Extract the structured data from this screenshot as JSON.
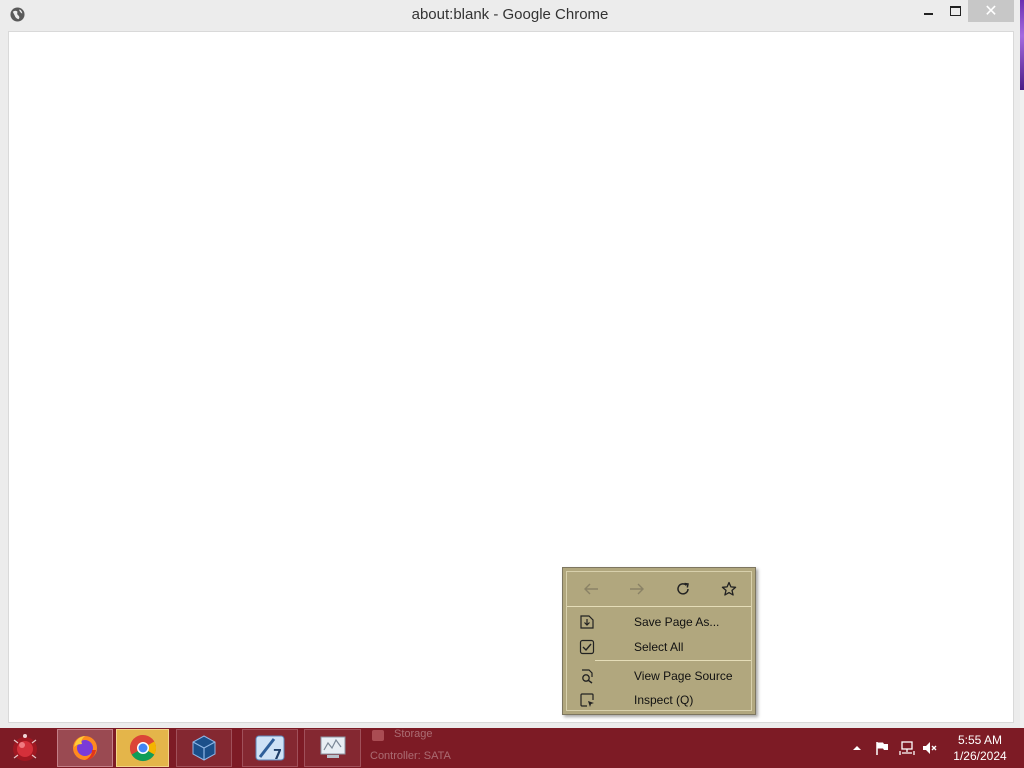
{
  "window": {
    "title": "about:blank - Google Chrome",
    "close_glyph": "✕"
  },
  "context_menu": {
    "nav": [
      {
        "name": "back",
        "icon": "arrow-left-icon",
        "enabled": false
      },
      {
        "name": "forward",
        "icon": "arrow-right-icon",
        "enabled": false
      },
      {
        "name": "reload",
        "icon": "reload-icon",
        "enabled": true
      },
      {
        "name": "bookmark",
        "icon": "star-icon",
        "enabled": true
      }
    ],
    "items": [
      {
        "label": "Save Page As...",
        "icon": "save-page-icon"
      },
      {
        "label": "Select All",
        "icon": "select-all-icon"
      },
      {
        "label": "View Page Source",
        "icon": "view-source-icon"
      },
      {
        "label": "Inspect (Q)",
        "icon": "inspect-icon"
      }
    ]
  },
  "taskbar": {
    "apps": [
      {
        "name": "Firefox",
        "icon": "firefox-icon"
      },
      {
        "name": "Google Chrome",
        "icon": "chrome-icon",
        "active": true
      },
      {
        "name": "VirtualBox",
        "icon": "virtualbox-icon"
      },
      {
        "name": "App 7",
        "icon": "app7-icon"
      },
      {
        "name": "Monitor",
        "icon": "monitor-icon"
      }
    ],
    "background_text": {
      "storage": "Storage",
      "controller": "Controller: SATA"
    },
    "clock": {
      "time": "5:55 AM",
      "date": "1/26/2024"
    }
  },
  "colors": {
    "taskbar": "#7d1b25",
    "context_menu_bg": "#b1a77e",
    "chrome_accent": "#e4b54a"
  }
}
